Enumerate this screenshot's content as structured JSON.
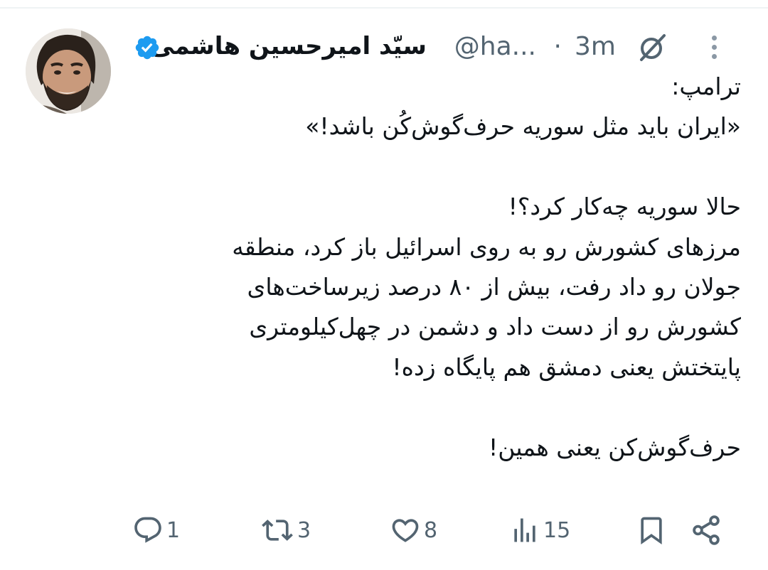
{
  "tweet": {
    "author": {
      "display_name": "سیّد امیرحسین هاشمی",
      "handle": "@ha...",
      "verified": true
    },
    "time_separator": "·",
    "time": "3m",
    "body_lines": [
      "ترامپ:",
      "«ایران باید مثل سوریه حرف‌گوش‌کُن باشد!»",
      "",
      "حالا سوریه چه‌کار کرد؟!",
      "مرزهای کشورش رو به روی اسرائیل باز کرد، منطقه",
      "جولان رو داد رفت، بیش از ۸۰ درصد زیرساخت‌های",
      "کشورش رو از دست داد و دشمن در چهل‌کیلومتری",
      "پایتختش یعنی دمشق هم پایگاه زده!",
      "",
      "حرف‌گوش‌کن یعنی همین!"
    ],
    "metrics": {
      "replies": "1",
      "reposts": "3",
      "likes": "8",
      "views": "15"
    }
  },
  "icons": {
    "verified": "verified-badge-icon",
    "grok": "grok-icon",
    "more": "more-dots-icon",
    "reply": "reply-icon",
    "repost": "repost-icon",
    "like": "heart-icon",
    "views": "views-bar-chart-icon",
    "bookmark": "bookmark-icon",
    "share": "share-icon"
  },
  "colors": {
    "text": "#0f1419",
    "secondary": "#536471",
    "verified": "#1d9bf0"
  }
}
